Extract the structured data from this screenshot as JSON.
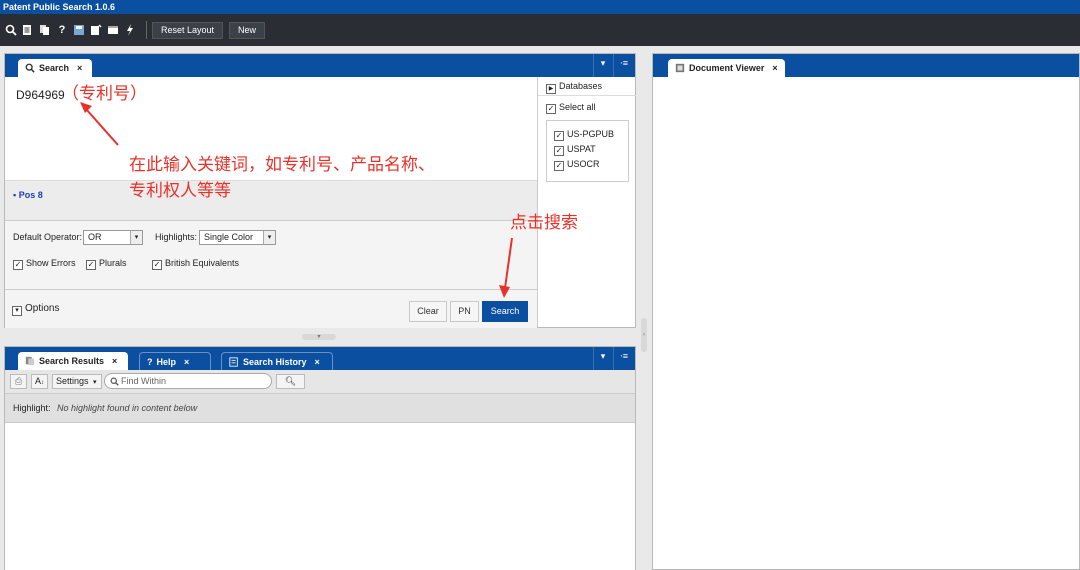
{
  "app": {
    "title": "Patent Public Search 1.0.6"
  },
  "toolbar": {
    "icons": [
      "search-icon",
      "document-list-icon",
      "copy-icon",
      "help-icon",
      "save-icon",
      "new-note-icon",
      "window-icon",
      "lightning-icon"
    ],
    "reset_layout_label": "Reset Layout",
    "new_label": "New"
  },
  "search_panel": {
    "tab_label": "Search",
    "tab_close": "×",
    "query_text": "D964969",
    "pos_label": "Pos 8",
    "default_operator_label": "Default Operator:",
    "default_operator_value": "OR",
    "highlights_label": "Highlights:",
    "highlights_value": "Single Color",
    "checkboxes": [
      {
        "label": "Show Errors",
        "checked": true
      },
      {
        "label": "Plurals",
        "checked": true
      },
      {
        "label": "British Equivalents",
        "checked": true
      }
    ],
    "options_label": "Options",
    "clear_label": "Clear",
    "pn_label": "PN",
    "search_label": "Search",
    "databases": {
      "header": "Databases",
      "select_all": "Select all",
      "items": [
        {
          "label": "US-PGPUB",
          "checked": true
        },
        {
          "label": "USPAT",
          "checked": true
        },
        {
          "label": "USOCR",
          "checked": true
        }
      ]
    }
  },
  "results_panel": {
    "tabs": [
      {
        "label": "Search Results",
        "close": "×"
      },
      {
        "label": "Help",
        "close": "×"
      },
      {
        "label": "Search History",
        "close": "×"
      }
    ],
    "settings_label": "Settings",
    "find_within_placeholder": "Find Within",
    "highlight_label": "Highlight:",
    "highlight_text": "No highlight found in content below"
  },
  "document_viewer": {
    "tab_label": "Document Viewer",
    "tab_close": "×"
  },
  "annotations": {
    "patent_no_note": "（专利号）",
    "keyword_note_line1": "在此输入关键词，如专利号、产品名称、",
    "keyword_note_line2": "专利权人等等",
    "click_search_note": "点击搜索"
  },
  "colors": {
    "brand_blue": "#0b4fa0",
    "annotation_red": "#e8312a",
    "toolbar_dark": "#2a2d33"
  }
}
